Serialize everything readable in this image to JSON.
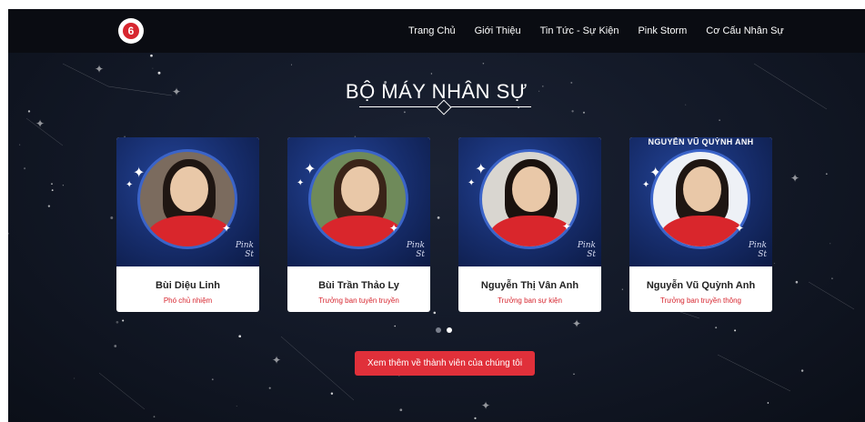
{
  "brand": {
    "logo_letter": "6",
    "accent": "#d7262f"
  },
  "nav": {
    "items": [
      {
        "label": "Trang Chủ"
      },
      {
        "label": "Giới Thiệu"
      },
      {
        "label": "Tin Tức - Sự Kiện"
      },
      {
        "label": "Pink Storm"
      },
      {
        "label": "Cơ Cấu Nhân Sự"
      }
    ]
  },
  "section": {
    "title": "BỘ MÁY NHÂN SỰ"
  },
  "members": [
    {
      "name": "Bùi Diệu Linh",
      "role": "Phó chủ nhiệm",
      "banner": ""
    },
    {
      "name": "Bùi Trần Thảo Ly",
      "role": "Trưởng ban tuyên truyền",
      "banner": ""
    },
    {
      "name": "Nguyễn Thị Vân Anh",
      "role": "Trưởng ban sự kiện",
      "banner": ""
    },
    {
      "name": "Nguyễn Vũ Quỳnh Anh",
      "role": "Trưởng ban truyền thông",
      "banner": "NGUYỄN VŨ QUỲNH ANH"
    }
  ],
  "photo_brand": {
    "line1": "Pink",
    "line2": "St"
  },
  "carousel": {
    "dot_count": 2,
    "active_index": 1
  },
  "cta": {
    "label": "Xem thêm về thành viên của chúng tôi"
  },
  "colors": {
    "nav_bg": "#0a0c12",
    "bg": "#141a28",
    "card_bg": "#ffffff",
    "cta_bg": "#e0303a"
  }
}
